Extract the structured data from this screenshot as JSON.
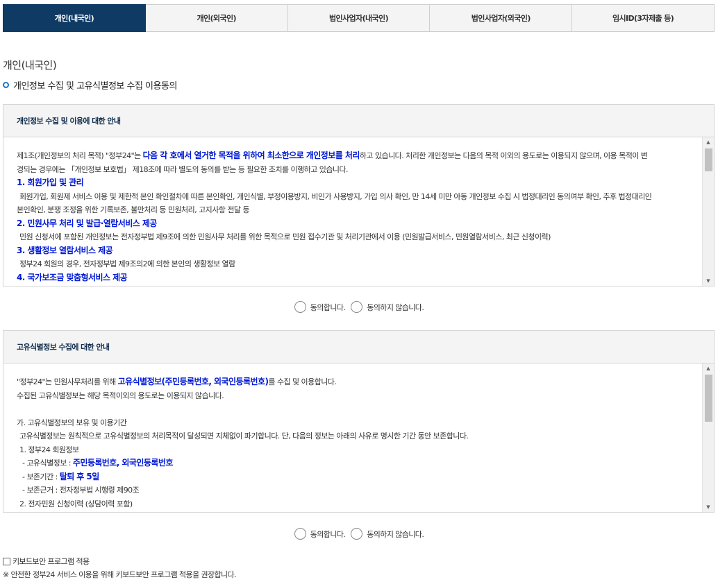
{
  "tabs": [
    {
      "label": "개인(내국인)",
      "active": true
    },
    {
      "label": "개인(외국인)",
      "active": false
    },
    {
      "label": "법인사업자(내국인)",
      "active": false
    },
    {
      "label": "법인사업자(외국인)",
      "active": false
    },
    {
      "label": "임시ID(3자제출 등)",
      "active": false
    }
  ],
  "page_title": "개인(내국인)",
  "section_heading": "개인정보 수집 및 고유식별정보 수집 이용동의",
  "privacy_panel": {
    "title": "개인정보 수집 및 이용에 대한 안내",
    "lines": {
      "l1a": "제1조(개인정보의 처리 목적) \"정부24\"는 ",
      "l1b": "다음 각 호에서 열거한 목적을 위하여 최소한으로 개인정보를 처리",
      "l1c": "하고 있습니다. 처리한 개인정보는 다음의 목적 이외의 용도로는 이용되지 않으며, 이용 목적이 변",
      "l2": "경되는 경우에는 「개인정보 보호법」 제18조에 따라 별도의 동의를 받는 등 필요한 조치를 이행하고 있습니다.",
      "h1": "1. 회원가입 및 관리",
      "l3": "회원가입, 회원제 서비스 이용 및 제한적 본인 확인절차에 따른 본인확인, 개인식별, 부정이용방지, 비인가 사용방지, 가입 의사 확인, 만 14세 미만 아동 개인정보 수집 시 법정대리인 동의여부 확인, 추후 법정대리인",
      "l4": "본인확인, 분쟁 조정을 위한 기록보존, 불만처리 등 민원처리, 고지사항 전달 등",
      "h2": "2. 민원사무 처리 및 발급·열람서비스 제공",
      "l5": "민원 신청서에 포함된 개인정보는 전자정부법 제9조에 의한 민원사무 처리를 위한 목적으로 민원 접수기관 및 처리기관에서 이용 (민원발급서비스, 민원열람서비스, 최근 신청이력)",
      "h3": "3. 생활정보 열람서비스 제공",
      "l6": "정부24 회원의 경우, 전자정부법 제9조의2에 의한 본인의 생활정보 열람",
      "h4": "4. 국가보조금 맞춤형서비스 제공"
    }
  },
  "agree_options": {
    "agree": "동의합니다.",
    "disagree": "동의하지 않습니다."
  },
  "unique_panel": {
    "title": "고유식별정보 수집에 대한 안내",
    "lines": {
      "l1a": "\"정부24\"는 민원사무처리를 위해 ",
      "l1b": "고유식별정보(주민등록번호, 외국인등록번호)",
      "l1c": "를 수집 및 이용합니다.",
      "l2": "수집된 고유식별정보는 해당 목적이외의 용도로는 이용되지 않습니다.",
      "l3": "가. 고유식별정보의 보유 및 이용기간",
      "l4": "고유식별정보는 원칙적으로 고유식별정보의 처리목적이 달성되면 지체없이 파기합니다. 단, 다음의 정보는 아래의 사유로 명시한 기간 동안 보존합니다.",
      "l5": "1. 정부24 회원정보",
      "l6a": "- 고유식별정보 : ",
      "l6b": "주민등록번호, 외국인등록번호",
      "l7a": "- 보존기간 : ",
      "l7b": "탈퇴 후 5일",
      "l8": "- 보존근거 : 전자정부법 시행령 제90조",
      "l9": "2. 전자민원 신청이력 (상담이력 포함)"
    }
  },
  "keyboard_security": {
    "label": "키보드보안 프로그램 적용",
    "note": "※ 안전한 정부24 서비스 이용을 위해 키보드보안 프로그램 적용을 권장합니다."
  }
}
